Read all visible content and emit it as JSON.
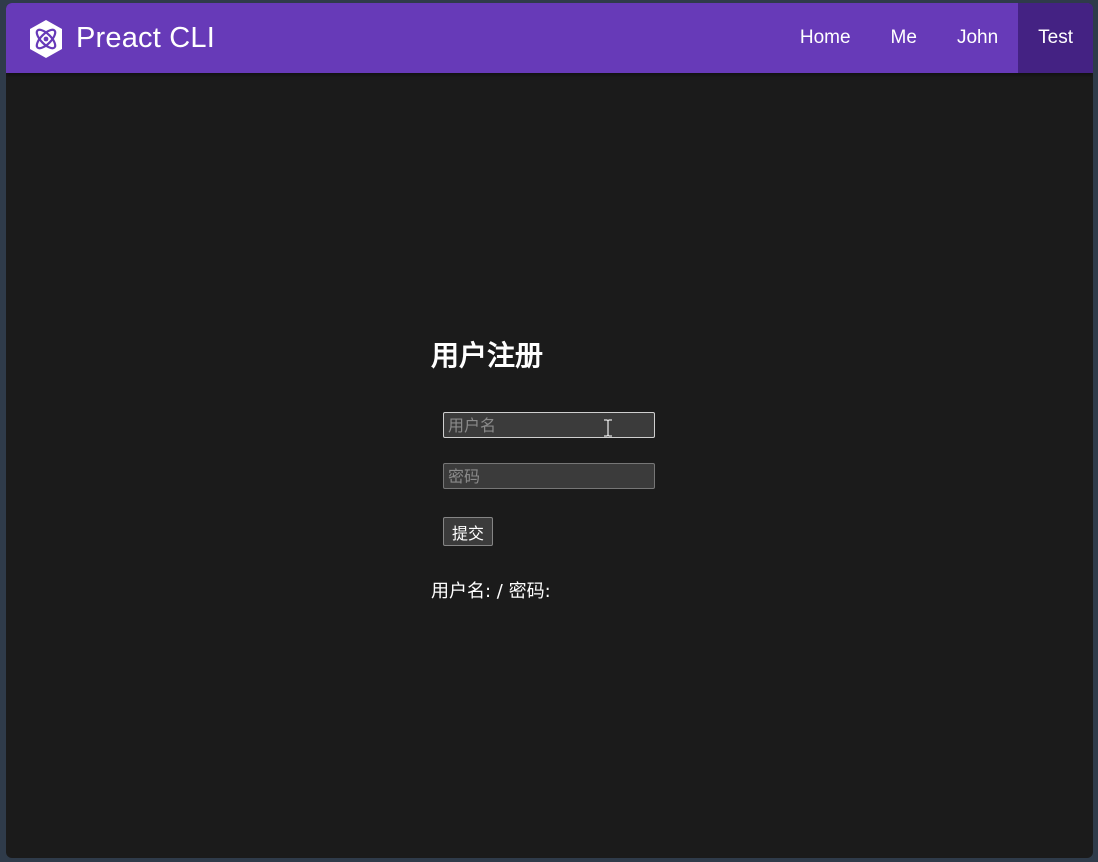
{
  "header": {
    "brand": "Preact CLI",
    "accent_color": "#673ab8",
    "active_color": "#442283",
    "logo_icon": "preact-hexagon-atom-icon",
    "nav": [
      {
        "label": "Home",
        "active": false
      },
      {
        "label": "Me",
        "active": false
      },
      {
        "label": "John",
        "active": false
      },
      {
        "label": "Test",
        "active": true
      }
    ]
  },
  "form": {
    "title": "用户注册",
    "username": {
      "placeholder": "用户名",
      "value": ""
    },
    "password": {
      "placeholder": "密码",
      "value": ""
    },
    "submit_label": "提交",
    "result_text": "用户名:   / 密码:"
  },
  "cursor_icon": "text-ibeam-cursor-icon"
}
